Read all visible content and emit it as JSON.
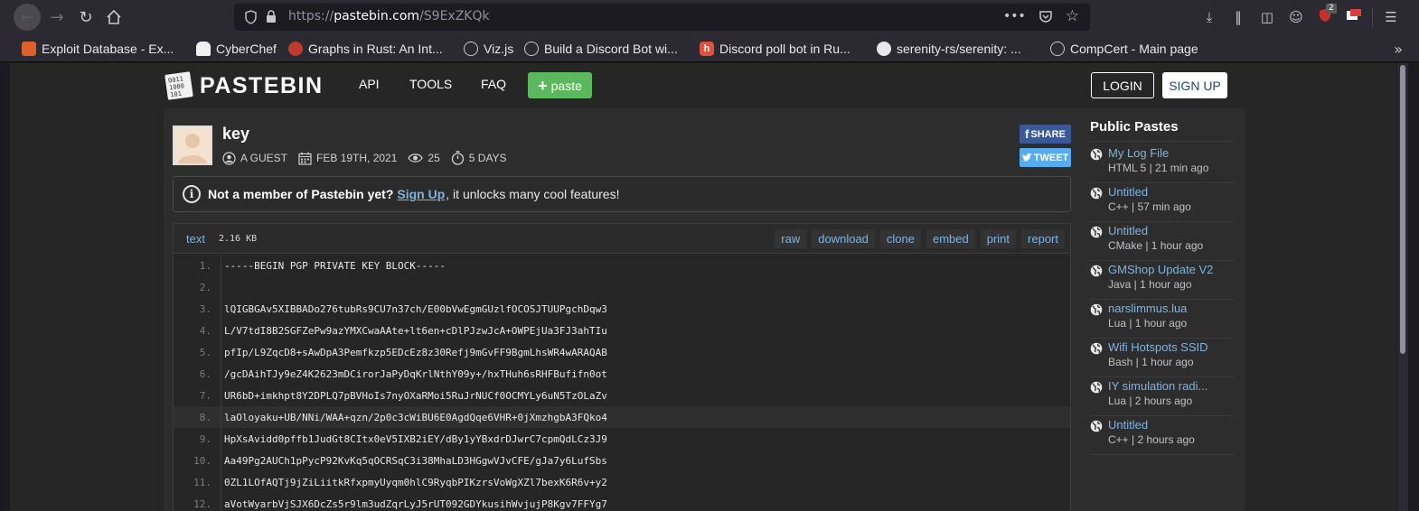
{
  "browser": {
    "url_prefix": "https://",
    "url_domain": "pastebin.com",
    "url_path": "/S9ExZKQk",
    "url_more": "•••",
    "notification_count": "2",
    "bookmarks": [
      {
        "label": "Exploit Database - Ex..."
      },
      {
        "label": "CyberChef"
      },
      {
        "label": "Graphs in Rust: An Int..."
      },
      {
        "label": "Viz.js"
      },
      {
        "label": "Build a Discord Bot wi..."
      },
      {
        "label": "Discord poll bot in Ru..."
      },
      {
        "label": "serenity-rs/serenity: ..."
      },
      {
        "label": "CompCert - Main page"
      }
    ]
  },
  "header": {
    "logo_text": "PASTEBIN",
    "nav": [
      "API",
      "TOOLS",
      "FAQ"
    ],
    "paste_label": "paste",
    "login_label": "LOGIN",
    "signup_label": "SIGN UP"
  },
  "paste": {
    "title": "key",
    "author": "A GUEST",
    "date": "FEB 19TH, 2021",
    "views": "25",
    "expires": "5 DAYS",
    "share_label": "SHARE",
    "tweet_label": "TWEET",
    "syntax": "text",
    "size": "2.16 KB",
    "actions": [
      "raw",
      "download",
      "clone",
      "embed",
      "print",
      "report"
    ],
    "lines": [
      {
        "n": "1.",
        "text": "-----BEGIN PGP PRIVATE KEY BLOCK-----"
      },
      {
        "n": "2.",
        "text": ""
      },
      {
        "n": "3.",
        "text": "lQIGBGAv5XIBBADo276tubRs9CU7n37ch/E00bVwEgmGUzlfOCOSJTUUPgchDqw3"
      },
      {
        "n": "4.",
        "text": "L/V7tdI8B2SGFZePw9azYMXCwaAAte+lt6en+cDlPJzwJcA+OWPEjUa3FJ3ahTIu"
      },
      {
        "n": "5.",
        "text": "pfIp/L9ZqcD8+sAwDpA3Pemfkzp5EDcEz8z30Refj9mGvFF9BgmLhsWR4wARAQAB"
      },
      {
        "n": "6.",
        "text": "/gcDAihTJy9eZ4K2623mDCirorJaPyDqKrlNthY09y+/hxTHuh6sRHFBufifn0ot"
      },
      {
        "n": "7.",
        "text": "UR6bD+imkhpt8Y2DPLQ7pBVHoIs7nyOXaRMoi5RuJrNUCf0OCMYLy6uN5TzOLaZv"
      },
      {
        "n": "8.",
        "text": "laOloyaku+UB/NNi/WAA+qzn/2p0c3cWiBU6E0AgdQqe6VHR+0jXmzhgbA3FQko4"
      },
      {
        "n": "9.",
        "text": "HpXsAvidd0pffb1JudGt8CItx0eV5IXB2iEY/dBy1yYBxdrDJwrC7cpmQdLCz3J9"
      },
      {
        "n": "10.",
        "text": "Aa49Pg2AUCh1pPycP92KvKq5qOCRSqC3i38MhaLD3HGgwVJvCFE/gJa7y6LufSbs"
      },
      {
        "n": "11.",
        "text": "0ZL1LOfAQTj9jZiLiitkRfxpmyUyqm0hlC9RyqbPIKzrsVoWgXZl7bexK6R6v+y2"
      },
      {
        "n": "12.",
        "text": "aVotWyarbVjSJX6DcZs5r9lm3udZqrLyJ5rUT092GDYkusihWvjujP8Kgv7FFYg7"
      }
    ]
  },
  "notice": {
    "bold_text": "Not a member of Pastebin yet?",
    "link_text": "Sign Up",
    "rest_text": ", it unlocks many cool features!"
  },
  "sidebar": {
    "title": "Public Pastes",
    "items": [
      {
        "title": "My Log File",
        "meta": "HTML 5 | 21 min ago"
      },
      {
        "title": "Untitled",
        "meta": "C++ | 57 min ago"
      },
      {
        "title": "Untitled",
        "meta": "CMake | 1 hour ago"
      },
      {
        "title": "GMShop Update V2",
        "meta": "Java | 1 hour ago"
      },
      {
        "title": "narslimmus.lua",
        "meta": "Lua | 1 hour ago"
      },
      {
        "title": "Wifi Hotspots SSID",
        "meta": "Bash | 1 hour ago"
      },
      {
        "title": "IY simulation radi...",
        "meta": "Lua | 2 hours ago"
      },
      {
        "title": "Untitled",
        "meta": "C++ | 2 hours ago"
      }
    ]
  },
  "colors": {
    "accent_link": "#7fb3e0",
    "paste_button": "#5cb85c",
    "facebook": "#3b5998",
    "twitter": "#55acee"
  }
}
